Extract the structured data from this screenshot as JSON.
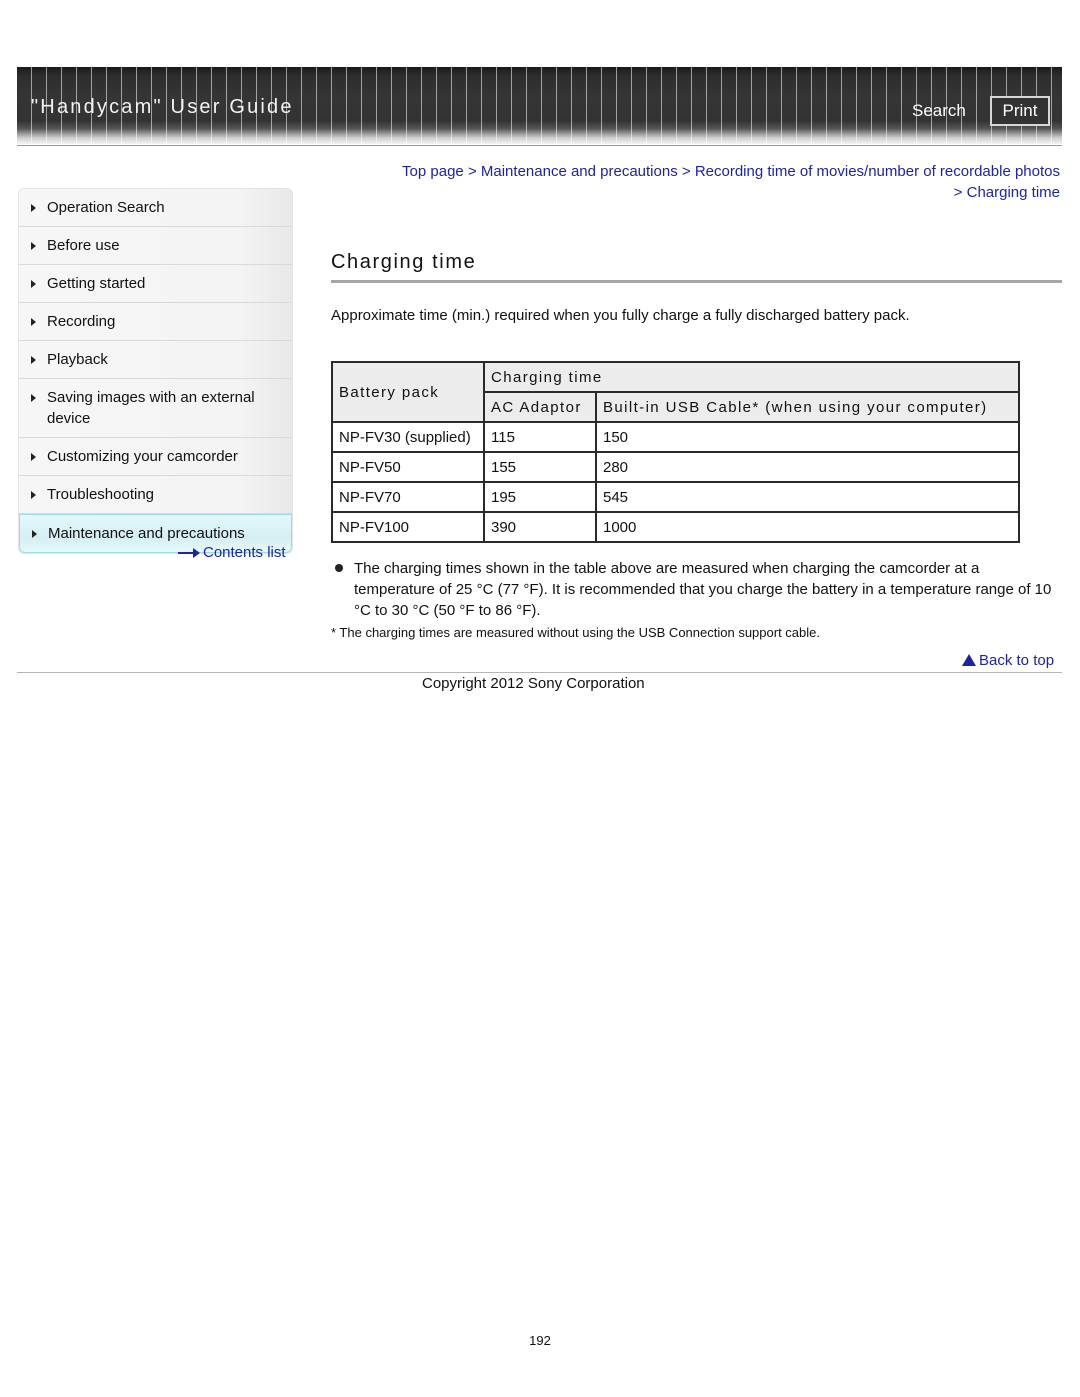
{
  "header": {
    "title": "\"Handycam\" User Guide",
    "search_label": "Search",
    "print_label": "Print"
  },
  "breadcrumb": {
    "items": [
      "Top page",
      "Maintenance and precautions",
      "Recording time of movies/number of recordable photos",
      "Charging time"
    ],
    "separator": ">"
  },
  "sidebar": {
    "items": [
      {
        "label": "Operation Search"
      },
      {
        "label": "Before use"
      },
      {
        "label": "Getting started"
      },
      {
        "label": "Recording"
      },
      {
        "label": "Playback"
      },
      {
        "label": "Saving images with an external device"
      },
      {
        "label": "Customizing your camcorder"
      },
      {
        "label": "Troubleshooting"
      },
      {
        "label": "Maintenance and precautions",
        "active": true
      }
    ],
    "contents_list_label": "Contents list"
  },
  "main": {
    "title": "Charging time",
    "intro": "Approximate time (min.) required when you fully charge a fully discharged battery pack.",
    "table": {
      "headers": {
        "battery_pack": "Battery pack",
        "charging_time": "Charging time",
        "ac_adaptor": "AC Adaptor",
        "usb_cable": "Built-in USB Cable* (when using your computer)"
      },
      "rows": [
        {
          "battery": "NP-FV30 (supplied)",
          "ac": "115",
          "usb": "150"
        },
        {
          "battery": "NP-FV50",
          "ac": "155",
          "usb": "280"
        },
        {
          "battery": "NP-FV70",
          "ac": "195",
          "usb": "545"
        },
        {
          "battery": "NP-FV100",
          "ac": "390",
          "usb": "1000"
        }
      ]
    },
    "note": "The charging times shown in the table above are measured when charging the camcorder at a temperature of 25 °C (77 °F). It is recommended that you charge the battery in a temperature range of 10 °C to 30 °C (50 °F to 86 °F).",
    "footnote": "* The charging times are measured without using the USB Connection support cable.",
    "back_to_top": "Back to top"
  },
  "footer": {
    "copyright": "Copyright 2012 Sony Corporation",
    "page_number": "192"
  }
}
